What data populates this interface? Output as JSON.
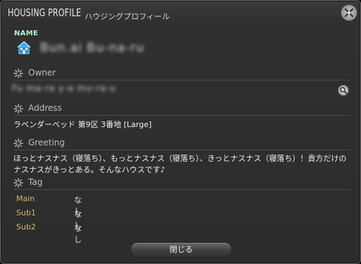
{
  "window": {
    "title_main": "HOUSING PROFILE",
    "title_sub": "ハウジングプロフィール"
  },
  "name": {
    "label": "NAME",
    "value_obscured": "Bun.ai Bu-na-ru"
  },
  "owner": {
    "label": "Owner",
    "value_obscured": "Fu ma-ra y-a mu-ra-u"
  },
  "address": {
    "label": "Address",
    "value": "ラベンダーベッド 第9区 3番地 [Large]"
  },
  "greeting": {
    "label": "Greeting",
    "text": "ほっとナスナス（寝落ち）、もっとナスナス（寝落ち）、きっとナスナス（寝落ち）！貴方だけのナスナスがきっとある。そんなハウスです♪"
  },
  "tag": {
    "label": "Tag",
    "rows": [
      {
        "key": "Main",
        "value": "なし"
      },
      {
        "key": "Sub1",
        "value": "なし"
      },
      {
        "key": "Sub2",
        "value": "なし"
      }
    ]
  },
  "buttons": {
    "close": "閉じる"
  },
  "colors": {
    "name_label": "#b6f2d0",
    "tag_key": "#d8b56c",
    "background": "#2e2e2e"
  }
}
